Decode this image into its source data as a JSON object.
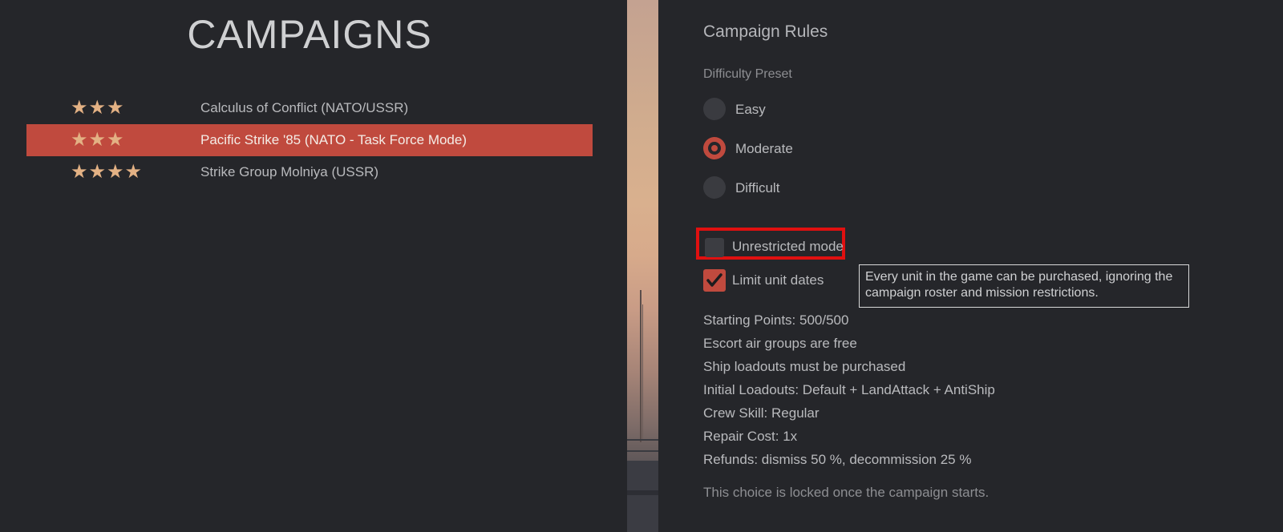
{
  "campaigns": {
    "title": "CAMPAIGNS",
    "items": [
      {
        "stars": "★★★",
        "star_count": 3,
        "name": "Calculus of Conflict (NATO/USSR)",
        "selected": false
      },
      {
        "stars": "★★★",
        "star_count": 3,
        "name": "Pacific Strike '85 (NATO - Task Force Mode)",
        "selected": true
      },
      {
        "stars": "★★★★",
        "star_count": 4,
        "name": "Strike Group Molniya (USSR)",
        "selected": false
      }
    ]
  },
  "rules": {
    "heading": "Campaign Rules",
    "difficulty_label": "Difficulty Preset",
    "difficulty_options": [
      {
        "label": "Easy",
        "checked": false
      },
      {
        "label": "Moderate",
        "checked": true
      },
      {
        "label": "Difficult",
        "checked": false
      }
    ],
    "unrestricted_mode": {
      "label": "Unrestricted mode",
      "checked": false
    },
    "limit_unit_dates": {
      "label": "Limit unit dates",
      "checked": true
    },
    "tooltip": "Every unit in the game can be purchased, ignoring the campaign roster and mission restrictions.",
    "info": [
      "Starting Points: 500/500",
      "Escort air groups are free",
      "Ship loadouts must be purchased",
      "Initial Loadouts: Default + LandAttack + AntiShip",
      "Crew Skill: Regular",
      "Repair Cost: 1x",
      "Refunds: dismiss 50 %, decommission 25 %"
    ],
    "locked_note": "This choice is locked once the campaign starts."
  },
  "colors": {
    "background": "#25262a",
    "accent": "#c04a3e",
    "star": "#e3b184",
    "highlight_outline": "#e01010"
  },
  "icons": {
    "star": "star-icon",
    "check": "checkmark-icon"
  }
}
